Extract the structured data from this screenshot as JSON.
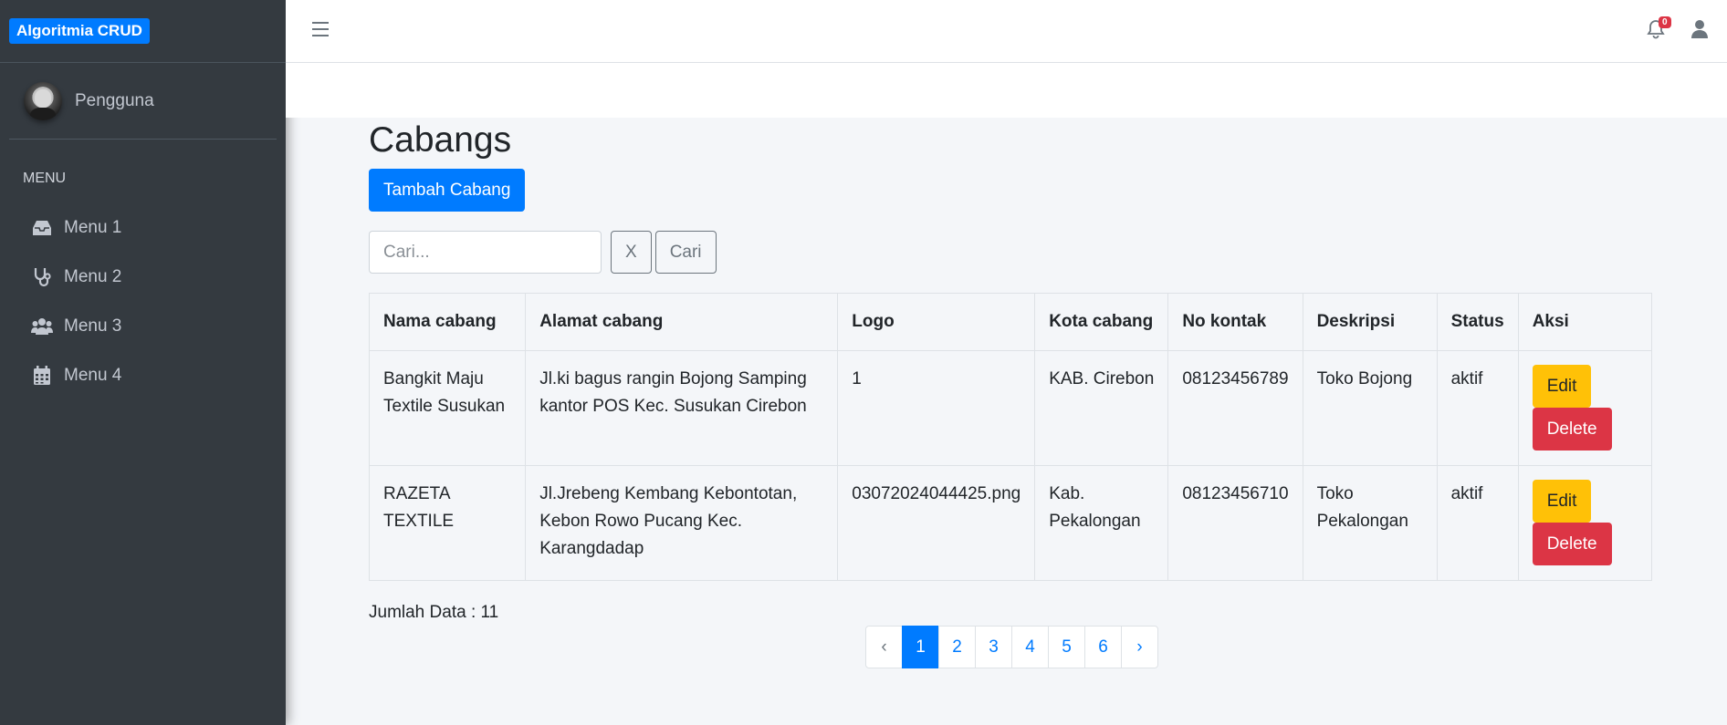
{
  "app": {
    "brand": "Algoritmia CRUD",
    "user_name": "Pengguna",
    "notification_count": "0"
  },
  "sidebar": {
    "header": "MENU",
    "items": [
      {
        "label": "Menu 1",
        "icon": "inbox-icon"
      },
      {
        "label": "Menu 2",
        "icon": "stethoscope-icon"
      },
      {
        "label": "Menu 3",
        "icon": "users-icon"
      },
      {
        "label": "Menu 4",
        "icon": "calendar-icon"
      }
    ]
  },
  "main": {
    "title": "Cabangs",
    "add_button": "Tambah Cabang",
    "search": {
      "placeholder": "Cari...",
      "value": "",
      "clear_label": "X",
      "submit_label": "Cari"
    },
    "table": {
      "columns": [
        "Nama cabang",
        "Alamat cabang",
        "Logo",
        "Kota cabang",
        "No kontak",
        "Deskripsi",
        "Status",
        "Aksi"
      ],
      "rows": [
        {
          "nama": "Bangkit Maju Textile Susukan",
          "alamat": "Jl.ki bagus rangin Bojong Samping kantor POS Kec. Susukan Cirebon",
          "logo": "1",
          "kota": "KAB. Cirebon",
          "kontak": "08123456789",
          "deskripsi": "Toko Bojong",
          "status": "aktif"
        },
        {
          "nama": "RAZETA TEXTILE",
          "alamat": "Jl.Jrebeng Kembang Kebontotan, Kebon Rowo Pucang Kec. Karangdadap",
          "logo": "03072024044425.png",
          "kota": "Kab. Pekalongan",
          "kontak": "08123456710",
          "deskripsi": "Toko Pekalongan",
          "status": "aktif"
        }
      ],
      "edit_label": "Edit",
      "delete_label": "Delete"
    },
    "count_text": "Jumlah Data : 11",
    "pagination": {
      "prev": "‹",
      "next": "›",
      "pages": [
        "1",
        "2",
        "3",
        "4",
        "5",
        "6"
      ],
      "active": "1"
    }
  },
  "colors": {
    "sidebar_bg": "#343a40",
    "primary": "#007bff",
    "warning": "#ffc107",
    "danger": "#dc3545",
    "content_bg": "#f4f6f9"
  }
}
